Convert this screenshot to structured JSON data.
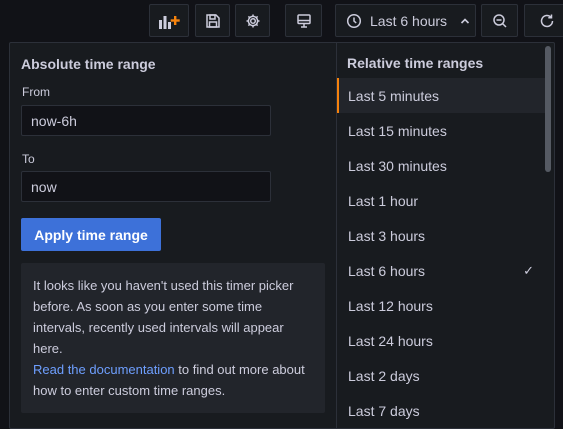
{
  "toolbar": {
    "time_picker_label": "Last 6 hours",
    "icons": [
      "add-panel-icon",
      "save-icon",
      "gear-icon",
      "monitor-icon",
      "clock-icon",
      "chevron-up-icon",
      "zoom-out-icon",
      "refresh-icon"
    ],
    "accent_color": "#f5820d"
  },
  "absolute": {
    "title": "Absolute time range",
    "from_label": "From",
    "from_value": "now-6h",
    "to_label": "To",
    "to_value": "now",
    "apply_label": "Apply time range",
    "info_text": "It looks like you haven't used this timer picker before. As soon as you enter some time intervals, recently used intervals will appear here.",
    "info_link": "Read the documentation",
    "info_suffix": " to find out more about how to enter custom time ranges."
  },
  "relative": {
    "title": "Relative time ranges",
    "items": [
      "Last 5 minutes",
      "Last 15 minutes",
      "Last 30 minutes",
      "Last 1 hour",
      "Last 3 hours",
      "Last 6 hours",
      "Last 12 hours",
      "Last 24 hours",
      "Last 2 days",
      "Last 7 days"
    ],
    "highlighted": "Last 5 minutes",
    "selected": "Last 6 hours",
    "check_glyph": "✓"
  }
}
